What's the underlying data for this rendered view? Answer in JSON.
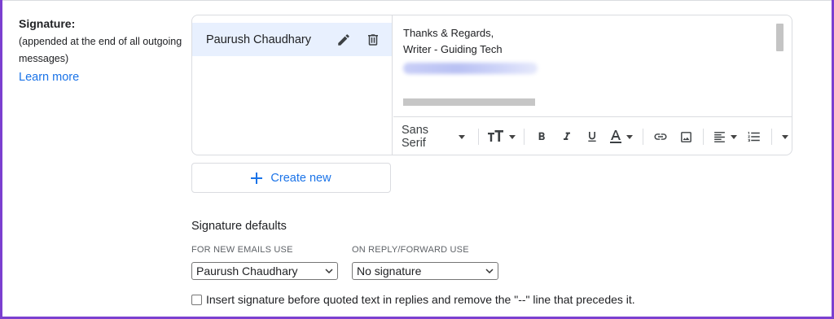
{
  "signature_section": {
    "title": "Signature:",
    "subtitle": "(appended at the end of all outgoing messages)",
    "learn_more": "Learn more"
  },
  "signatures": [
    {
      "name": "Paurush Chaudhary"
    }
  ],
  "editor": {
    "lines": [
      "Thanks & Regards,",
      "Writer - Guiding Tech"
    ],
    "font": "Sans Serif"
  },
  "create_new_label": "Create new",
  "defaults": {
    "title": "Signature defaults",
    "new_emails_label": "FOR NEW EMAILS USE",
    "new_emails_value": "Paurush Chaudhary",
    "reply_label": "ON REPLY/FORWARD USE",
    "reply_value": "No signature",
    "insert_before_label": "Insert signature before quoted text in replies and remove the \"--\" line that precedes it.",
    "insert_before_checked": false
  },
  "colors": {
    "accent": "#1a73e8",
    "selected_bg": "#e8f0fe",
    "frame": "#7b3fd0"
  }
}
